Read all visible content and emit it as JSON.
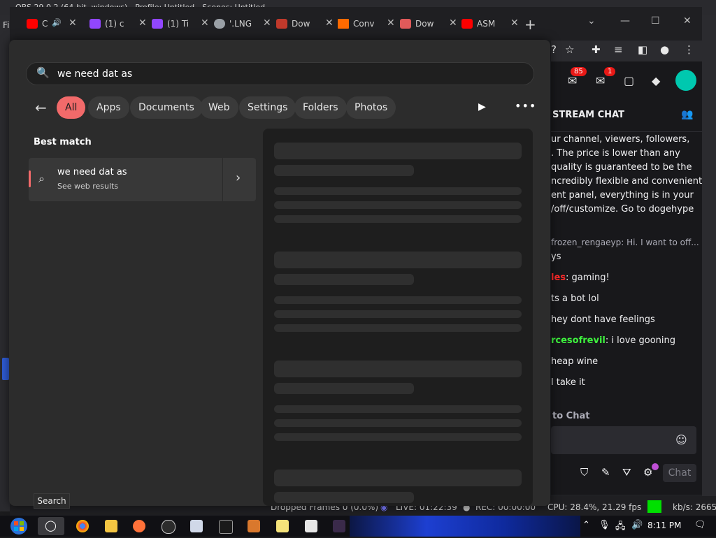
{
  "obs": {
    "title": "OBS 29.0.2 (64-bit, windows) - Profile: Untitled - Scenes: Untitled",
    "menu_label": "Fi",
    "status": {
      "dropped": "Dropped Frames 0 (0.0%)",
      "live": "LIVE: 01:22:39",
      "rec": "REC: 00:00:00",
      "cpu": "CPU: 28.4%, 21.29 fps",
      "kbs": "kb/s: 2665"
    }
  },
  "browser": {
    "tabs": [
      {
        "label": "C",
        "icon": "youtube-icon",
        "color": "#ff0000"
      },
      {
        "label": "(1) c",
        "icon": "twitch-icon",
        "color": "#9146ff"
      },
      {
        "label": "(1) Ti",
        "icon": "twitch-icon",
        "color": "#9146ff"
      },
      {
        "label": "'.LNG",
        "icon": "globe-icon",
        "color": "#9aa0a6"
      },
      {
        "label": "Dow",
        "icon": "download-site-icon",
        "color": "#c0392b"
      },
      {
        "label": "Conv",
        "icon": "convert-site-icon",
        "color": "#ff6a00"
      },
      {
        "label": "Dow",
        "icon": "download-site-icon",
        "color": "#e05a5a"
      },
      {
        "label": "ASM",
        "icon": "youtube-icon",
        "color": "#ff0000"
      }
    ],
    "new_tab": "+"
  },
  "twitch": {
    "notif_count": "85",
    "inbox_count": "1",
    "chat_title": "STREAM CHAT",
    "messages": [
      {
        "user": "",
        "text": "ur channel, viewers, followers,"
      },
      {
        "user": "",
        "text": ". The price is lower than any"
      },
      {
        "user": "",
        "text": "quality is guaranteed to be the"
      },
      {
        "user": "",
        "text": "ncredibly flexible and convenient"
      },
      {
        "user": "",
        "text": "ent panel, everything is in your"
      },
      {
        "user": "",
        "text": "/off/customize. Go to dogehype"
      },
      {
        "user": "",
        "text": "frozen_rengaeyp: Hi. I want to off..."
      },
      {
        "user": "",
        "text": "ys"
      },
      {
        "user": "les",
        "text": ": gaming!"
      },
      {
        "user": "",
        "text": "ts a bot lol"
      },
      {
        "user": "",
        "text": "hey dont have feelings"
      },
      {
        "user": "rcesofrevil",
        "text": ": i love gooning"
      },
      {
        "user": "",
        "text": "heap wine"
      },
      {
        "user": "",
        "text": "l take it"
      }
    ],
    "input_label": "to Chat",
    "chat_button": "Chat"
  },
  "search": {
    "query": "we need dat as",
    "filters": [
      "All",
      "Apps",
      "Documents",
      "Web",
      "Settings",
      "Folders",
      "Photos"
    ],
    "active_filter": "All",
    "best_match_heading": "Best match",
    "result": {
      "title": "we need dat as",
      "subtitle": "See web results"
    },
    "tooltip": "Search"
  },
  "taskbar": {
    "time": "8:11 PM"
  }
}
